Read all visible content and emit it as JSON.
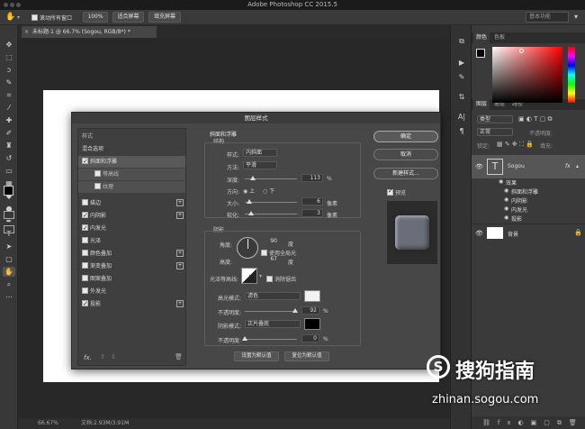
{
  "app": {
    "title": "Adobe Photoshop CC 2015.5"
  },
  "options_bar": {
    "scroll_all_label": "滚动所有窗口",
    "zoom_label": "100%",
    "fit_screen_label": "适合屏幕",
    "fill_screen_label": "填充屏幕",
    "workspace_label": "基本功能"
  },
  "document": {
    "tab_title": "未标题-1 @ 66.7% (Sogou, RGB/8*) *"
  },
  "status": {
    "zoom": "66.67%",
    "doc_info": "文档:2.93M/3.91M"
  },
  "right_panel": {
    "color_tabs": [
      "颜色",
      "色板"
    ],
    "layer_tabs": [
      "图层",
      "通道",
      "路径"
    ],
    "kind_label": "类型",
    "normal_label": "正常",
    "opacity_label": "不透明度:",
    "lock_label": "锁定:",
    "fill_label": "填充:",
    "layers": [
      {
        "name": "Sogou",
        "fx": "fx"
      },
      {
        "name": "效果"
      },
      {
        "name": "斜面和浮雕"
      },
      {
        "name": "内阴影"
      },
      {
        "name": "内发光"
      },
      {
        "name": "投影"
      },
      {
        "name": "背景"
      }
    ]
  },
  "dialog": {
    "title": "图层样式",
    "styles_header": "样式",
    "blend_options": "混合选项",
    "items": [
      {
        "label": "斜面和浮雕",
        "checked": true
      },
      {
        "label": "等高线",
        "checked": false
      },
      {
        "label": "纹理",
        "checked": false
      },
      {
        "label": "描边",
        "checked": false
      },
      {
        "label": "内阴影",
        "checked": true
      },
      {
        "label": "内发光",
        "checked": true
      },
      {
        "label": "光泽",
        "checked": false
      },
      {
        "label": "颜色叠加",
        "checked": false
      },
      {
        "label": "渐变叠加",
        "checked": false
      },
      {
        "label": "图案叠加",
        "checked": false
      },
      {
        "label": "外发光",
        "checked": false
      },
      {
        "label": "投影",
        "checked": true
      }
    ],
    "fx_label": "fx.",
    "bevel": {
      "section_title": "斜面和浮雕",
      "structure_title": "结构",
      "style_label": "样式:",
      "style_value": "内斜面",
      "technique_label": "方法:",
      "technique_value": "平滑",
      "depth_label": "深度:",
      "depth_value": "113",
      "depth_unit": "%",
      "direction_label": "方向:",
      "dir_up": "上",
      "dir_down": "下",
      "size_label": "大小:",
      "size_value": "6",
      "size_unit": "像素",
      "soften_label": "软化:",
      "soften_value": "3",
      "soften_unit": "像素"
    },
    "shading": {
      "title": "阴影",
      "angle_label": "角度:",
      "angle_value": "90",
      "angle_unit": "度",
      "global_light": "使用全局光",
      "altitude_label": "高度:",
      "altitude_value": "67",
      "altitude_unit": "度",
      "gloss_label": "光泽等高线:",
      "anti_alias": "消除锯齿",
      "highlight_label": "高光模式:",
      "highlight_value": "滤色",
      "hl_opacity_label": "不透明度:",
      "hl_opacity_value": "92",
      "hl_opacity_unit": "%",
      "shadow_label": "阴影模式:",
      "shadow_value": "正片叠底",
      "sh_opacity_label": "不透明度:",
      "sh_opacity_value": "0",
      "sh_opacity_unit": "%",
      "highlight_color": "#f2f2f2",
      "shadow_color": "#000000"
    },
    "set_default": "设置为默认值",
    "reset_default": "复位为默认值",
    "ok": "确定",
    "cancel": "取消",
    "new_style": "新建样式...",
    "preview": "预览"
  },
  "watermark": {
    "brand": "搜狗指南",
    "url": "zhinan.sogou.com"
  }
}
